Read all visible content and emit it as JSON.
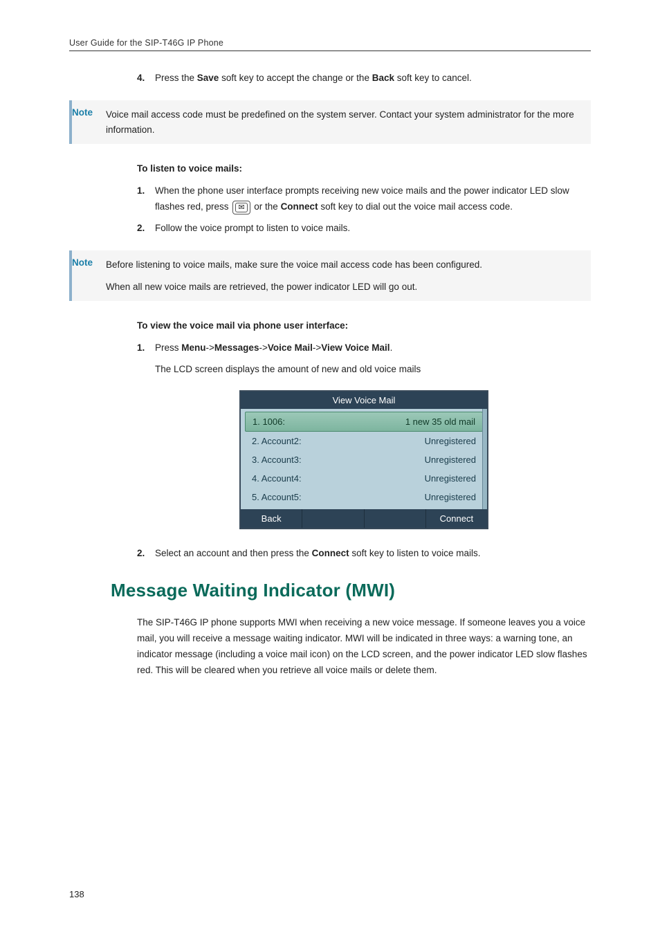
{
  "header": {
    "title": "User Guide for the SIP-T46G IP Phone"
  },
  "list4": {
    "num": "4.",
    "pre": "Press the ",
    "save": "Save",
    "mid": " soft key to accept the change or the ",
    "back": "Back",
    "post": " soft key to cancel."
  },
  "note1": {
    "label": "Note",
    "text": "Voice mail access code must be predefined on the system server. Contact your system administrator for the more information."
  },
  "listen": {
    "heading": "To listen to voice mails:",
    "s1": {
      "num": "1.",
      "pre": "When the phone user interface prompts receiving new voice mails and the power indicator LED slow flashes red, press ",
      "mid": " or the ",
      "connect": "Connect",
      "post": " soft key to dial out the voice mail access code."
    },
    "s2": {
      "num": "2.",
      "text": "Follow the voice prompt to listen to voice mails."
    }
  },
  "note2": {
    "label": "Note",
    "p1": "Before listening to voice mails, make sure the voice mail access code has been configured.",
    "p2": "When all new voice mails are retrieved, the power indicator LED will go out."
  },
  "view": {
    "heading": "To view the voice mail via phone user interface:",
    "s1": {
      "num": "1.",
      "pre": "Press ",
      "menu": "Menu",
      "arrow1": "->",
      "messages": "Messages",
      "arrow2": "->",
      "vm": "Voice Mail",
      "arrow3": "->",
      "vvm": "View Voice Mail",
      "dot": "."
    },
    "s1_after": "The LCD screen displays the amount of new and old voice mails",
    "s2": {
      "num": "2.",
      "pre": "Select an account and then press the ",
      "connect": "Connect",
      "post": " soft key to listen to voice mails."
    }
  },
  "lcd": {
    "title": "View Voice Mail",
    "rows": [
      {
        "label": "1. 1006:",
        "status": "1 new 35 old mail",
        "selected": true
      },
      {
        "label": "2. Account2:",
        "status": "Unregistered",
        "selected": false
      },
      {
        "label": "3. Account3:",
        "status": "Unregistered",
        "selected": false
      },
      {
        "label": "4. Account4:",
        "status": "Unregistered",
        "selected": false
      },
      {
        "label": "5. Account5:",
        "status": "Unregistered",
        "selected": false
      }
    ],
    "soft": {
      "back": "Back",
      "connect": "Connect"
    }
  },
  "mwi": {
    "title": "Message Waiting Indicator (MWI)",
    "para": "The SIP-T46G IP phone supports MWI when receiving a new voice message. If someone leaves you a voice mail, you will receive a message waiting indicator. MWI will be indicated in three ways: a warning tone, an indicator message (including a voice mail icon) on the LCD screen, and the power indicator LED slow flashes red. This will be cleared when you retrieve all voice mails or delete them."
  },
  "page_number": "138"
}
